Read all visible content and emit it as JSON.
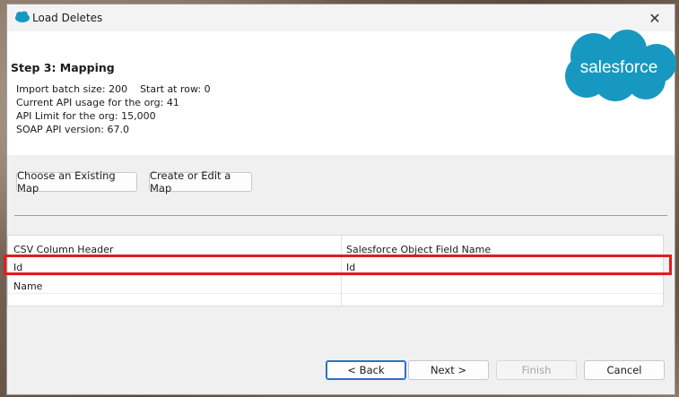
{
  "window": {
    "title": "Load Deletes",
    "close_glyph": "✕"
  },
  "header": {
    "step_title": "Step 3: Mapping",
    "batch_line": "Import batch size: 200    Start at row: 0",
    "api_usage_line": "Current API usage for the org: 41",
    "api_limit_line": "API Limit for the org: 15,000",
    "soap_line": "SOAP API version: 67.0",
    "logo_text": "salesforce"
  },
  "mapping_buttons": {
    "choose_existing": "Choose an Existing Map",
    "create_edit": "Create or Edit a Map"
  },
  "grid": {
    "columns": [
      "CSV Column Header",
      "Salesforce Object Field Name"
    ],
    "rows": [
      [
        "Id",
        "Id"
      ],
      [
        "Name",
        ""
      ]
    ]
  },
  "footer": {
    "back": "< Back",
    "next": "Next >",
    "finish": "Finish",
    "cancel": "Cancel"
  },
  "colors": {
    "salesforce_blue": "#1798c1",
    "highlight_red": "#e11d1d"
  }
}
